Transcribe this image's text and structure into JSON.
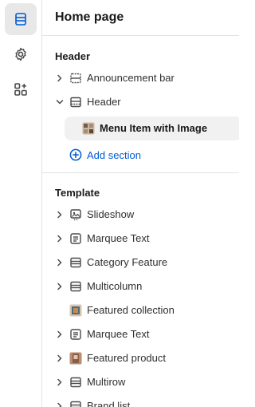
{
  "page": {
    "title": "Home page"
  },
  "rail": {
    "items": [
      {
        "icon": "sections-icon",
        "active": true
      },
      {
        "icon": "gear-icon",
        "active": false
      },
      {
        "icon": "apps-icon",
        "active": false
      }
    ]
  },
  "header_group": {
    "title": "Header",
    "items": [
      {
        "label": "Announcement bar",
        "icon": "section-icon",
        "expanded": false
      },
      {
        "label": "Header",
        "icon": "section-icon",
        "expanded": true
      }
    ],
    "child": {
      "label": "Menu Item with Image",
      "icon": "image-thumb-icon"
    },
    "add_label": "Add section"
  },
  "template_group": {
    "title": "Template",
    "items": [
      {
        "label": "Slideshow",
        "icon": "slideshow-icon"
      },
      {
        "label": "Marquee Text",
        "icon": "text-icon"
      },
      {
        "label": "Category Feature",
        "icon": "section-icon"
      },
      {
        "label": "Multicolumn",
        "icon": "section-icon"
      },
      {
        "label": "Featured collection",
        "icon": "image-thumb-icon"
      },
      {
        "label": "Marquee Text",
        "icon": "text-icon"
      },
      {
        "label": "Featured product",
        "icon": "image-thumb-icon"
      },
      {
        "label": "Multirow",
        "icon": "section-icon"
      },
      {
        "label": "Brand list",
        "icon": "section-icon"
      }
    ]
  },
  "colors": {
    "accent": "#005bd3",
    "active_bg": "#e8e8e8",
    "child_bg": "#f1f1f1",
    "border": "#e3e3e3"
  }
}
